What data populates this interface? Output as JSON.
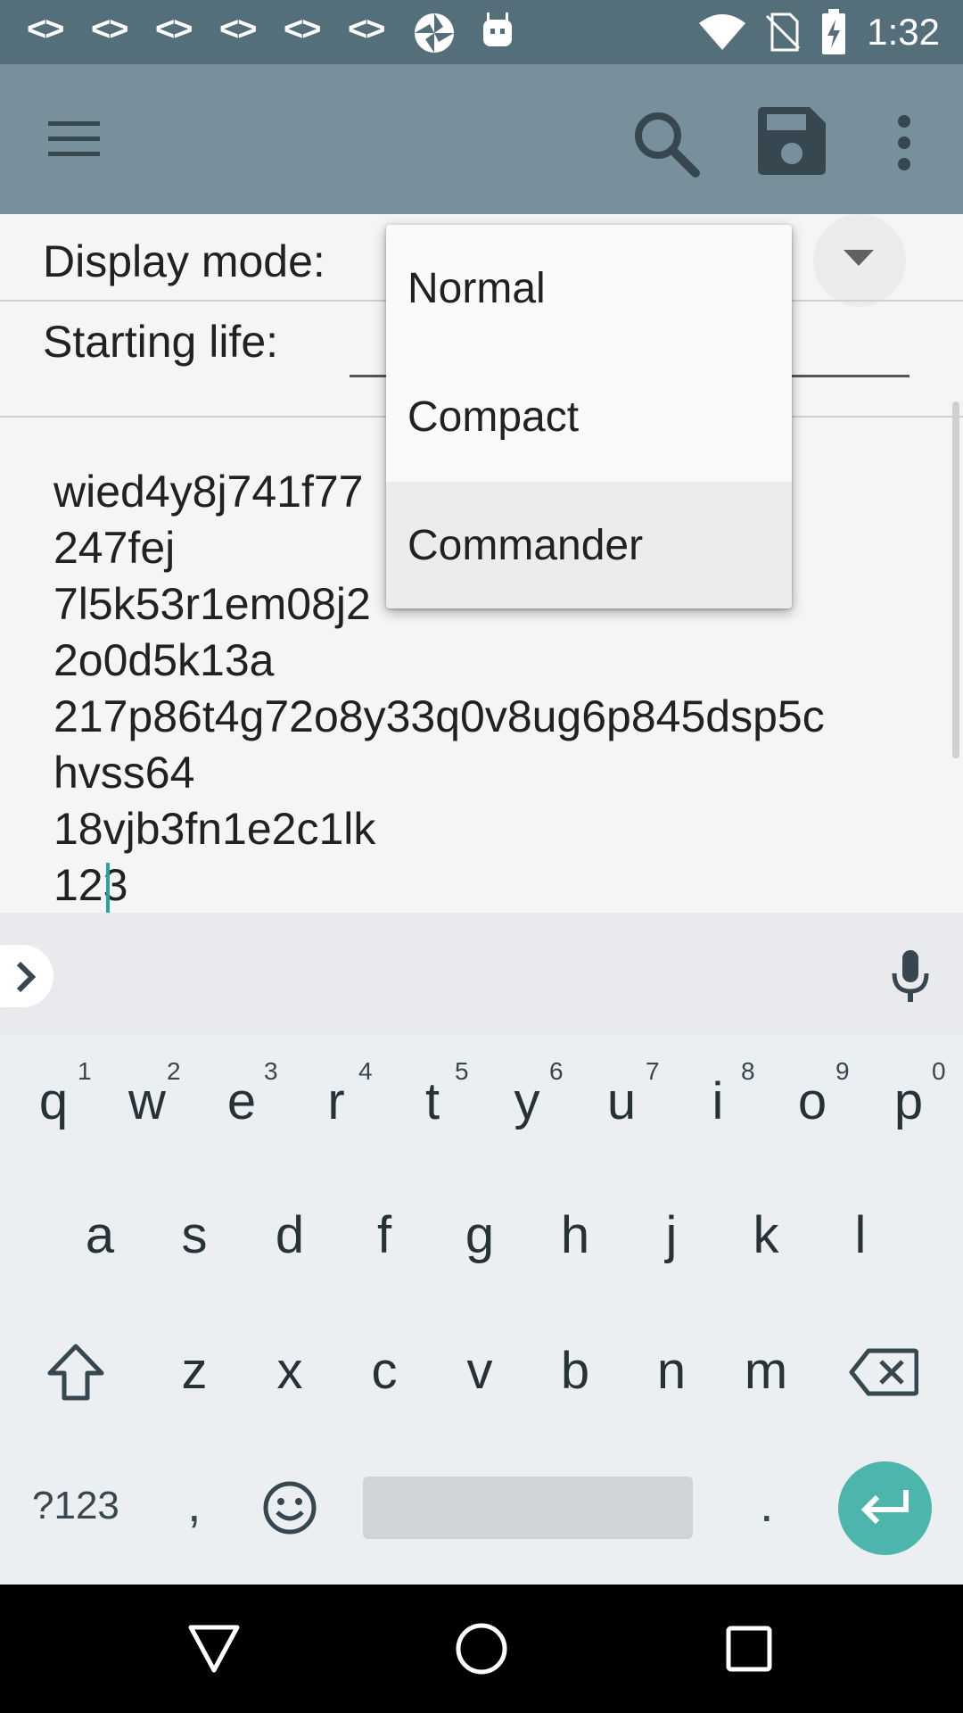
{
  "status_bar": {
    "notification_codes": [
      "<>",
      "<>",
      "<>",
      "<>",
      "<>",
      "<>"
    ],
    "icons": [
      "pinwheel-icon",
      "android-icon",
      "wifi-icon",
      "no-sim-icon",
      "battery-charging-icon"
    ],
    "time": "1:32"
  },
  "toolbar": {
    "menu_icon": "menu-icon",
    "search_icon": "search-icon",
    "save_icon": "save-icon",
    "overflow_icon": "more-vert-icon"
  },
  "settings": {
    "display_mode_label": "Display mode:",
    "starting_life_label": "Starting life:"
  },
  "dropdown": {
    "options": [
      "Normal",
      "Compact",
      "Commander"
    ],
    "highlighted_index": 2
  },
  "text_area": {
    "lines": [
      "wied4y8j741f77",
      "247fej",
      "7l5k53r1em08j2",
      "2o0d5k13a",
      "217p86t4g72o8y33q0v8ug6p845dsp5c",
      "hvss64",
      "18vjb3fn1e2c1lk",
      "123"
    ]
  },
  "keyboard": {
    "row1": [
      "q",
      "w",
      "e",
      "r",
      "t",
      "y",
      "u",
      "i",
      "o",
      "p"
    ],
    "row1_hints": [
      "1",
      "2",
      "3",
      "4",
      "5",
      "6",
      "7",
      "8",
      "9",
      "0"
    ],
    "row2": [
      "a",
      "s",
      "d",
      "f",
      "g",
      "h",
      "j",
      "k",
      "l"
    ],
    "row3": [
      "z",
      "x",
      "c",
      "v",
      "b",
      "n",
      "m"
    ],
    "symbols_label": "?123",
    "comma": ",",
    "period": ".",
    "accent_color": "#4db6ac"
  }
}
